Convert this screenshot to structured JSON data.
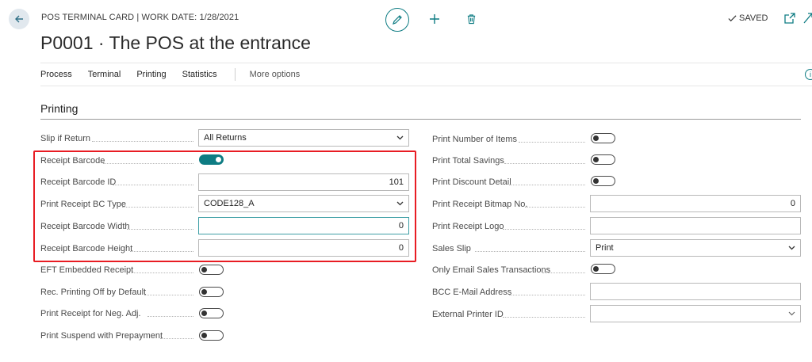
{
  "header": {
    "caption": "POS TERMINAL CARD | WORK DATE: 1/28/2021",
    "title": "P0001 · The POS at the entrance",
    "saved_label": "SAVED"
  },
  "icons": {
    "back": "back-arrow-icon",
    "edit": "pencil-icon",
    "add": "plus-icon",
    "delete": "trash-icon",
    "saved": "checkmark-icon",
    "popout": "open-in-new-window-icon",
    "info": "info-icon"
  },
  "tabs": [
    "Process",
    "Terminal",
    "Printing",
    "Statistics"
  ],
  "more_options": "More options",
  "section": {
    "title": "Printing"
  },
  "left_fields": {
    "slip_if_return": {
      "label": "Slip if Return",
      "value": "All Returns"
    },
    "receipt_barcode": {
      "label": "Receipt Barcode",
      "on": true
    },
    "receipt_barcode_id": {
      "label": "Receipt Barcode ID",
      "value": "101"
    },
    "print_receipt_bc_type": {
      "label": "Print Receipt BC Type",
      "value": "CODE128_A"
    },
    "receipt_barcode_width": {
      "label": "Receipt Barcode Width",
      "value": "0"
    },
    "receipt_barcode_height": {
      "label": "Receipt Barcode Height",
      "value": "0"
    },
    "eft_embedded_receipt": {
      "label": "EFT Embedded Receipt",
      "on": false
    },
    "rec_printing_off": {
      "label": "Rec. Printing Off by Default",
      "on": false
    },
    "print_receipt_neg_adj": {
      "label": "Print Receipt for Neg. Adj.",
      "on": false
    },
    "print_suspend_prepayment": {
      "label": "Print Suspend with Prepayment",
      "on": false
    }
  },
  "right_fields": {
    "print_number_of_items": {
      "label": "Print Number of Items",
      "on": false
    },
    "print_total_savings": {
      "label": "Print Total Savings",
      "on": false
    },
    "print_discount_detail": {
      "label": "Print Discount Detail",
      "on": false
    },
    "print_receipt_bitmap_no": {
      "label": "Print Receipt Bitmap No.",
      "value": "0"
    },
    "print_receipt_logo": {
      "label": "Print Receipt Logo",
      "value": ""
    },
    "sales_slip": {
      "label": "Sales Slip",
      "value": "Print"
    },
    "only_email_sales": {
      "label": "Only Email Sales Transactions",
      "on": false
    },
    "bcc_email": {
      "label": "BCC E-Mail Address",
      "value": ""
    },
    "external_printer_id": {
      "label": "External Printer ID",
      "value": ""
    }
  },
  "colors": {
    "accent": "#0e7c83",
    "highlight": "#e81c23"
  }
}
